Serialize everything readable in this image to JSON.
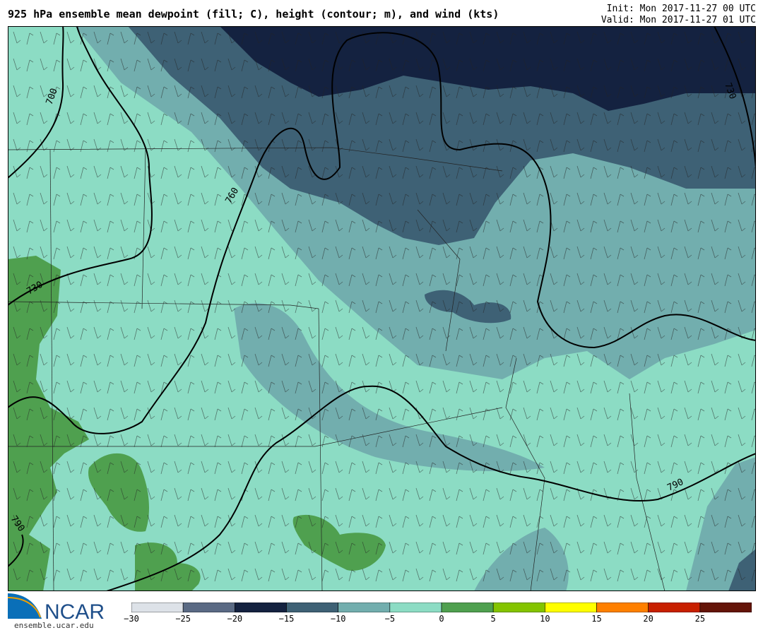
{
  "header": {
    "title": "925 hPa ensemble mean dewpoint (fill; C), height (contour; m), and wind (kts)",
    "init": "Init: Mon 2017-11-27 00 UTC",
    "valid": "Valid: Mon 2017-11-27 01 UTC"
  },
  "map": {
    "contour_labels": [
      "700",
      "730",
      "760",
      "730",
      "790",
      "790"
    ],
    "fill_colors": {
      "lt_-20": "#142240",
      "-20_-15": "#3e6175",
      "-15_-10": "#72aeae",
      "-10_-5": "#72aeae",
      "-5_0": "#8cdcc4",
      "0_5": "#4fa04f"
    }
  },
  "colorbar": {
    "colors": [
      "#dde2e8",
      "#5a6a84",
      "#142240",
      "#3e6175",
      "#72aeae",
      "#8cdcc4",
      "#4fa04f",
      "#84c400",
      "#ffff00",
      "#ff8000",
      "#c82000",
      "#641408"
    ],
    "ticks": [
      "−30",
      "−25",
      "−20",
      "−15",
      "−10",
      "−5",
      "0",
      "5",
      "10",
      "15",
      "20",
      "25"
    ]
  },
  "logo": {
    "text": "NCAR",
    "url": "ensemble.ucar.edu"
  }
}
